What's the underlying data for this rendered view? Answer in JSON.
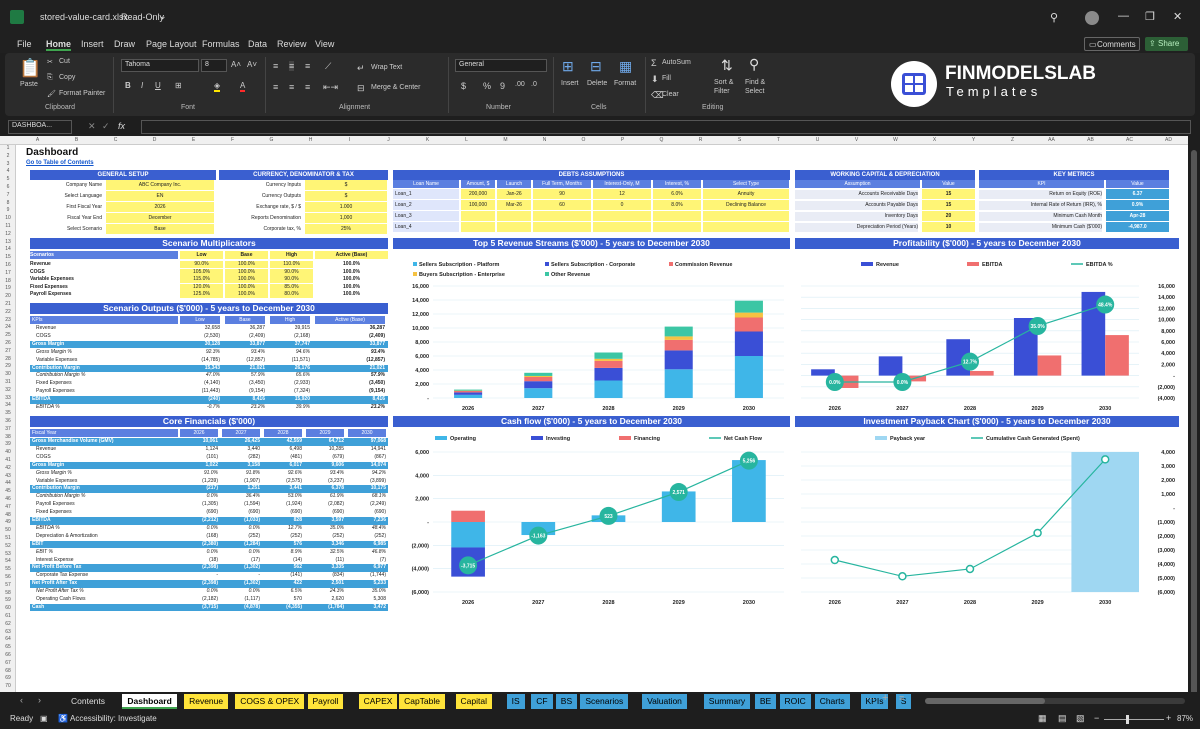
{
  "window": {
    "filename": "stored-value-card.xlsx",
    "mode": "Read-Only",
    "minimize": "—",
    "maximize": "❐",
    "close": "✕"
  },
  "menu": [
    "File",
    "Home",
    "Insert",
    "Draw",
    "Page Layout",
    "Formulas",
    "Data",
    "Review",
    "View"
  ],
  "menu_right": {
    "comments": "Comments",
    "share": "Share"
  },
  "ribbon": {
    "paste": "Paste",
    "cut": "Cut",
    "copy": "Copy",
    "format_painter": "Format Painter",
    "clipboard": "Clipboard",
    "font_name": "Tahoma",
    "font_size": "8",
    "font_group": "Font",
    "wrap_text": "Wrap Text",
    "merge_center": "Merge & Center",
    "alignment": "Alignment",
    "number_format": "General",
    "number": "Number",
    "insert": "Insert",
    "delete": "Delete",
    "format": "Format",
    "cells": "Cells",
    "autosum": "AutoSum",
    "fill": "Fill",
    "clear": "Clear",
    "sort_filter": "Sort & Filter",
    "find_select": "Find & Select",
    "editing": "Editing",
    "logo_line1": "FINMODELSLAB",
    "logo_line2": "Templates"
  },
  "namebox": "DASHBOA...",
  "fx": "fx",
  "columns": [
    "A",
    "B",
    "C",
    "D",
    "E",
    "F",
    "G",
    "H",
    "I",
    "J",
    "K",
    "L",
    "M",
    "N",
    "O",
    "P",
    "Q",
    "R",
    "S",
    "T",
    "U",
    "V",
    "W",
    "X",
    "Y",
    "Z",
    "AA",
    "AB",
    "AC",
    "AD"
  ],
  "sheet": {
    "title": "Dashboard",
    "toc": "Go to Table of Contents"
  },
  "general_setup": {
    "header": "GENERAL SETUP",
    "rows": [
      [
        "Company Name",
        "ABC Company Inc."
      ],
      [
        "Select Language",
        "EN"
      ],
      [
        "First Fiscal Year",
        "2026"
      ],
      [
        "Fiscal Year End",
        "December"
      ],
      [
        "Select Scenario",
        "Base"
      ]
    ]
  },
  "currency": {
    "header": "CURRENCY, DENOMINATOR & TAX",
    "rows": [
      [
        "Currency Inputs",
        "$"
      ],
      [
        "Currency Outputs",
        "$"
      ],
      [
        "Exchange rate, $ / $",
        "1.000"
      ],
      [
        "Reports Denomination",
        "1,000"
      ],
      [
        "Corporate tax, %",
        "25%"
      ]
    ]
  },
  "debts": {
    "header": "DEBTS ASSUMPTIONS",
    "cols": [
      "Loan Name",
      "Amount, $",
      "Launch",
      "Full Term, Months",
      "Interest-Only, M",
      "Interest, %",
      "Select Type"
    ],
    "rows": [
      [
        "Loan_1",
        "200,000",
        "Jan-26",
        "90",
        "12",
        "6.0%",
        "Annuity"
      ],
      [
        "Loan_2",
        "100,000",
        "Mar-26",
        "60",
        "0",
        "8.0%",
        "Declining Balance"
      ],
      [
        "Loan_3",
        "",
        "",
        "",
        "",
        "",
        ""
      ],
      [
        "Loan_4",
        "",
        "",
        "",
        "",
        "",
        ""
      ]
    ]
  },
  "wc": {
    "header": "WORKING CAPITAL & DEPRECIATION",
    "cols": [
      "Assumption",
      "Value"
    ],
    "rows": [
      [
        "Accounts Receivable Days",
        "15"
      ],
      [
        "Accounts Payable Days",
        "15"
      ],
      [
        "Inventory Days",
        "20"
      ],
      [
        "Depreciation Period (Years)",
        "10"
      ]
    ]
  },
  "kpis": {
    "header": "KEY METRICS",
    "cols": [
      "KPI",
      "Value"
    ],
    "rows": [
      [
        "Return on Equity (ROE)",
        "6.37"
      ],
      [
        "Internal Rate of Return (IRR), %",
        "0.9%"
      ],
      [
        "Minimum Cash Month",
        "Apr-28"
      ],
      [
        "Minimum Cash ($'000)",
        "-4,987.0"
      ]
    ]
  },
  "multipliers": {
    "header": "Scenario Multiplicators",
    "cols": [
      "Scenarios",
      "Low",
      "Base",
      "High",
      "Active (Base)"
    ],
    "rows": [
      [
        "Revenue",
        "90.0%",
        "100.0%",
        "110.0%",
        "100.0%"
      ],
      [
        "COGS",
        "105.0%",
        "100.0%",
        "90.0%",
        "100.0%"
      ],
      [
        "Variable Expenses",
        "115.0%",
        "100.0%",
        "90.0%",
        "100.0%"
      ],
      [
        "Fixed Expenses",
        "120.0%",
        "100.0%",
        "85.0%",
        "100.0%"
      ],
      [
        "Payroll Expenses",
        "125.0%",
        "100.0%",
        "80.0%",
        "100.0%"
      ]
    ]
  },
  "outputs": {
    "header": "Scenario Outputs ($'000) - 5 years to December 2030",
    "cols": [
      "KPIs",
      "Low",
      "Base",
      "High",
      "Active (Base)"
    ],
    "rows": [
      {
        "k": "Revenue",
        "v": [
          "32,658",
          "36,287",
          "39,915",
          "36,287"
        ],
        "t": "n"
      },
      {
        "k": "COGS",
        "v": [
          "(2,530)",
          "(2,409)",
          "(2,168)",
          "(2,409)"
        ],
        "t": "n"
      },
      {
        "k": "Gross Margin",
        "v": [
          "30,128",
          "33,877",
          "37,747",
          "33,877"
        ],
        "t": "b"
      },
      {
        "k": "Gross Margin %",
        "v": [
          "92.3%",
          "93.4%",
          "94.6%",
          "93.4%"
        ],
        "t": "i"
      },
      {
        "k": "Variable Expenses",
        "v": [
          "(14,785)",
          "(12,857)",
          "(11,571)",
          "(12,857)"
        ],
        "t": "n"
      },
      {
        "k": "Contribution Margin",
        "v": [
          "15,343",
          "21,021",
          "26,176",
          "21,021"
        ],
        "t": "b"
      },
      {
        "k": "Contribution Margin %",
        "v": [
          "47.0%",
          "57.9%",
          "65.6%",
          "57.9%"
        ],
        "t": "i"
      },
      {
        "k": "Fixed Expenses",
        "v": [
          "(4,140)",
          "(3,450)",
          "(2,933)",
          "(3,450)"
        ],
        "t": "n"
      },
      {
        "k": "Payroll Expenses",
        "v": [
          "(11,443)",
          "(9,154)",
          "(7,324)",
          "(9,154)"
        ],
        "t": "n"
      },
      {
        "k": "EBITDA",
        "v": [
          "(240)",
          "8,416",
          "15,920",
          "8,416"
        ],
        "t": "b"
      },
      {
        "k": "EBITDA %",
        "v": [
          "-0.7%",
          "23.2%",
          "39.9%",
          "23.2%"
        ],
        "t": "i"
      }
    ]
  },
  "core": {
    "header": "Core Financials ($'000)",
    "cols": [
      "Fiscal Year",
      "2026",
      "2027",
      "2028",
      "2029",
      "2030"
    ],
    "rows": [
      {
        "k": "Gross Merchandise Volume (GMV)",
        "v": [
          "10,061",
          "26,425",
          "42,559",
          "64,712",
          "97,068"
        ],
        "t": "b"
      },
      {
        "k": "Revenue",
        "v": [
          "1,124",
          "3,440",
          "6,498",
          "10,285",
          "14,941"
        ],
        "t": "n"
      },
      {
        "k": "COGS",
        "v": [
          "(101)",
          "(282)",
          "(481)",
          "(679)",
          "(867)"
        ],
        "t": "n"
      },
      {
        "k": "Gross Margin",
        "v": [
          "1,022",
          "3,158",
          "6,017",
          "9,606",
          "14,074"
        ],
        "t": "b"
      },
      {
        "k": "Gross Margin %",
        "v": [
          "91.0%",
          "91.8%",
          "92.6%",
          "93.4%",
          "94.2%"
        ],
        "t": "i"
      },
      {
        "k": "Variable Expenses",
        "v": [
          "(1,239)",
          "(1,907)",
          "(2,575)",
          "(3,237)",
          "(3,899)"
        ],
        "t": "n"
      },
      {
        "k": "Contribution Margin",
        "v": [
          "(217)",
          "1,251",
          "3,441",
          "6,378",
          "10,175"
        ],
        "t": "b"
      },
      {
        "k": "Contribution Margin %",
        "v": [
          "0.0%",
          "36.4%",
          "53.0%",
          "61.9%",
          "68.1%"
        ],
        "t": "i"
      },
      {
        "k": "Payroll Expenses",
        "v": [
          "(1,305)",
          "(1,594)",
          "(1,924)",
          "(2,082)",
          "(2,249)"
        ],
        "t": "n"
      },
      {
        "k": "Fixed Expenses",
        "v": [
          "(690)",
          "(690)",
          "(690)",
          "(690)",
          "(690)"
        ],
        "t": "n"
      },
      {
        "k": "EBITDA",
        "v": [
          "(2,212)",
          "(1,033)",
          "828",
          "3,597",
          "7,236"
        ],
        "t": "b"
      },
      {
        "k": "EBITDA %",
        "v": [
          "0.0%",
          "0.0%",
          "12.7%",
          "35.0%",
          "48.4%"
        ],
        "t": "i"
      },
      {
        "k": "Depreciation & Amortization",
        "v": [
          "(168)",
          "(252)",
          "(252)",
          "(252)",
          "(252)"
        ],
        "t": "n"
      },
      {
        "k": "EBIT",
        "v": [
          "(2,380)",
          "(1,284)",
          "576",
          "3,346",
          "6,985"
        ],
        "t": "b"
      },
      {
        "k": "EBIT %",
        "v": [
          "0.0%",
          "0.0%",
          "8.9%",
          "32.5%",
          "46.8%"
        ],
        "t": "i"
      },
      {
        "k": "Interest Expense",
        "v": [
          "(18)",
          "(17)",
          "(14)",
          "(11)",
          "(7)"
        ],
        "t": "n"
      },
      {
        "k": "Net Profit Before Tax",
        "v": [
          "(2,398)",
          "(1,302)",
          "562",
          "3,335",
          "6,977"
        ],
        "t": "b"
      },
      {
        "k": "Corporate Tax Expense",
        "v": [
          "-",
          "-",
          "(141)",
          "(834)",
          "(1,744)"
        ],
        "t": "n"
      },
      {
        "k": "Net Profit After Tax",
        "v": [
          "(2,398)",
          "(1,302)",
          "422",
          "2,501",
          "5,233"
        ],
        "t": "b"
      },
      {
        "k": "Net Profit After Tax %",
        "v": [
          "0.0%",
          "0.0%",
          "6.5%",
          "24.3%",
          "35.0%"
        ],
        "t": "i"
      },
      {
        "k": "Operating Cash Flows",
        "v": [
          "(2,182)",
          "(1,117)",
          "570",
          "2,620",
          "5,308"
        ],
        "t": "n"
      },
      {
        "k": "Cash",
        "v": [
          "(3,715)",
          "(4,878)",
          "(4,355)",
          "(1,784)",
          "3,472"
        ],
        "t": "b"
      }
    ]
  },
  "row_numbers": [
    "1",
    "2",
    "3",
    "4",
    "5",
    "6",
    "7",
    "8",
    "9",
    "10",
    "11",
    "12",
    "13",
    "14",
    "15",
    "16",
    "17",
    "18",
    "19",
    "20",
    "21",
    "22",
    "23",
    "24",
    "25",
    "26",
    "27",
    "28",
    "29",
    "30",
    "31",
    "32",
    "33",
    "34",
    "35",
    "36",
    "37",
    "38",
    "39",
    "40",
    "41",
    "42",
    "43",
    "44",
    "45",
    "46",
    "47",
    "48",
    "49",
    "50",
    "51",
    "52",
    "53",
    "54",
    "55",
    "56",
    "57",
    "58",
    "59",
    "60",
    "61",
    "62",
    "63",
    "64",
    "65",
    "66",
    "67",
    "68",
    "69",
    "70"
  ],
  "chart_data": [
    {
      "type": "bar",
      "title": "Top 5 Revenue Streams ($'000) - 5 years to December 2030",
      "stacked": true,
      "categories": [
        "2026",
        "2027",
        "2028",
        "2029",
        "2030"
      ],
      "series": [
        {
          "name": "Sellers Subscription - Platform",
          "color": "#3fb6e8",
          "values": [
            450,
            1400,
            2500,
            4100,
            6000
          ]
        },
        {
          "name": "Sellers Subscription - Corporate",
          "color": "#3a4fd6",
          "values": [
            350,
            1000,
            1800,
            2700,
            3500
          ]
        },
        {
          "name": "Commission Revenue",
          "color": "#f06f6f",
          "values": [
            200,
            600,
            1000,
            1500,
            2000
          ]
        },
        {
          "name": "Buyers Subscription - Enterprise",
          "color": "#f5c242",
          "values": [
            50,
            150,
            300,
            500,
            700
          ]
        },
        {
          "name": "Other Revenue",
          "color": "#3cc6a4",
          "values": [
            150,
            450,
            900,
            1400,
            1700
          ]
        }
      ],
      "yticks": [
        "16,000",
        "14,000",
        "12,000",
        "10,000",
        "8,000",
        "6,000",
        "4,000",
        "2,000",
        "-"
      ],
      "ylim": [
        0,
        16000
      ]
    },
    {
      "type": "bar",
      "title": "Profitability ($'000) - 5 years to December 2030",
      "categories": [
        "2026",
        "2027",
        "2028",
        "2029",
        "2030"
      ],
      "series": [
        {
          "name": "Revenue",
          "color": "#3a4fd6",
          "values": [
            1124,
            3440,
            6498,
            10285,
            14941
          ]
        },
        {
          "name": "EBITDA",
          "color": "#f06f6f",
          "values": [
            -2212,
            -1033,
            828,
            3597,
            7236
          ]
        },
        {
          "name": "EBITDA %",
          "color": "#27b59f",
          "type": "line",
          "values": [
            0.0,
            0.0,
            12.7,
            35.0,
            48.4
          ]
        }
      ],
      "point_labels": [
        "0.0%",
        "0.0%",
        "12.7%",
        "35.0%",
        "48.4%"
      ],
      "yticks": [
        "16,000",
        "14,000",
        "12,000",
        "10,000",
        "8,000",
        "6,000",
        "4,000",
        "2,000",
        "-",
        "(2,000)",
        "(4,000)"
      ],
      "ylim": [
        -4000,
        16000
      ]
    },
    {
      "type": "bar",
      "title": "Cash flow ($'000) - 5 years to December 2030",
      "stacked": true,
      "categories": [
        "2026",
        "2027",
        "2028",
        "2029",
        "2030"
      ],
      "series": [
        {
          "name": "Operating",
          "color": "#3fb6e8",
          "values": [
            -2182,
            -1117,
            570,
            2620,
            5308
          ]
        },
        {
          "name": "Investing",
          "color": "#3a4fd6",
          "values": [
            -2500,
            0,
            0,
            0,
            0
          ]
        },
        {
          "name": "Financing",
          "color": "#f06f6f",
          "values": [
            967,
            0,
            0,
            0,
            0
          ]
        },
        {
          "name": "Net Cash Flow",
          "color": "#27b59f",
          "type": "line",
          "values": [
            -3715,
            -1163,
            523,
            2571,
            5256
          ]
        }
      ],
      "point_labels": [
        "-3,715",
        "-1,163",
        "523",
        "2,571",
        "5,256"
      ],
      "yticks": [
        "6,000",
        "4,000",
        "2,000",
        "-",
        "(2,000)",
        "(4,000)",
        "(6,000)"
      ],
      "ylim": [
        -6000,
        6000
      ]
    },
    {
      "type": "bar",
      "title": "Investment Payback Chart ($'000) - 5 years to December 2030",
      "categories": [
        "2026",
        "2027",
        "2028",
        "2029",
        "2030"
      ],
      "series": [
        {
          "name": "Payback year",
          "color": "#9fd7f2",
          "values": [
            0,
            0,
            0,
            0,
            1
          ]
        },
        {
          "name": "Cumulative Cash Generated (Spent)",
          "color": "#27b59f",
          "type": "line",
          "values": [
            -3715,
            -4878,
            -4355,
            -1784,
            3472
          ]
        }
      ],
      "yticks": [
        "4,000",
        "3,000",
        "2,000",
        "1,000",
        "-",
        "(1,000)",
        "(2,000)",
        "(3,000)",
        "(4,000)",
        "(5,000)",
        "(6,000)"
      ],
      "ylim": [
        -6000,
        4000
      ]
    }
  ],
  "tabs": [
    "Contents",
    "Dashboard",
    "Revenue",
    "COGS & OPEX",
    "Payroll",
    "CAPEX",
    "CapTable",
    "Capital",
    "IS",
    "CF",
    "BS",
    "Scenarios",
    "Valuation",
    "Summary",
    "BE",
    "ROIC",
    "Charts",
    "KPIs",
    "S"
  ],
  "status": {
    "ready": "Ready",
    "accessibility": "Accessibility: Investigate",
    "zoom": "87%"
  }
}
